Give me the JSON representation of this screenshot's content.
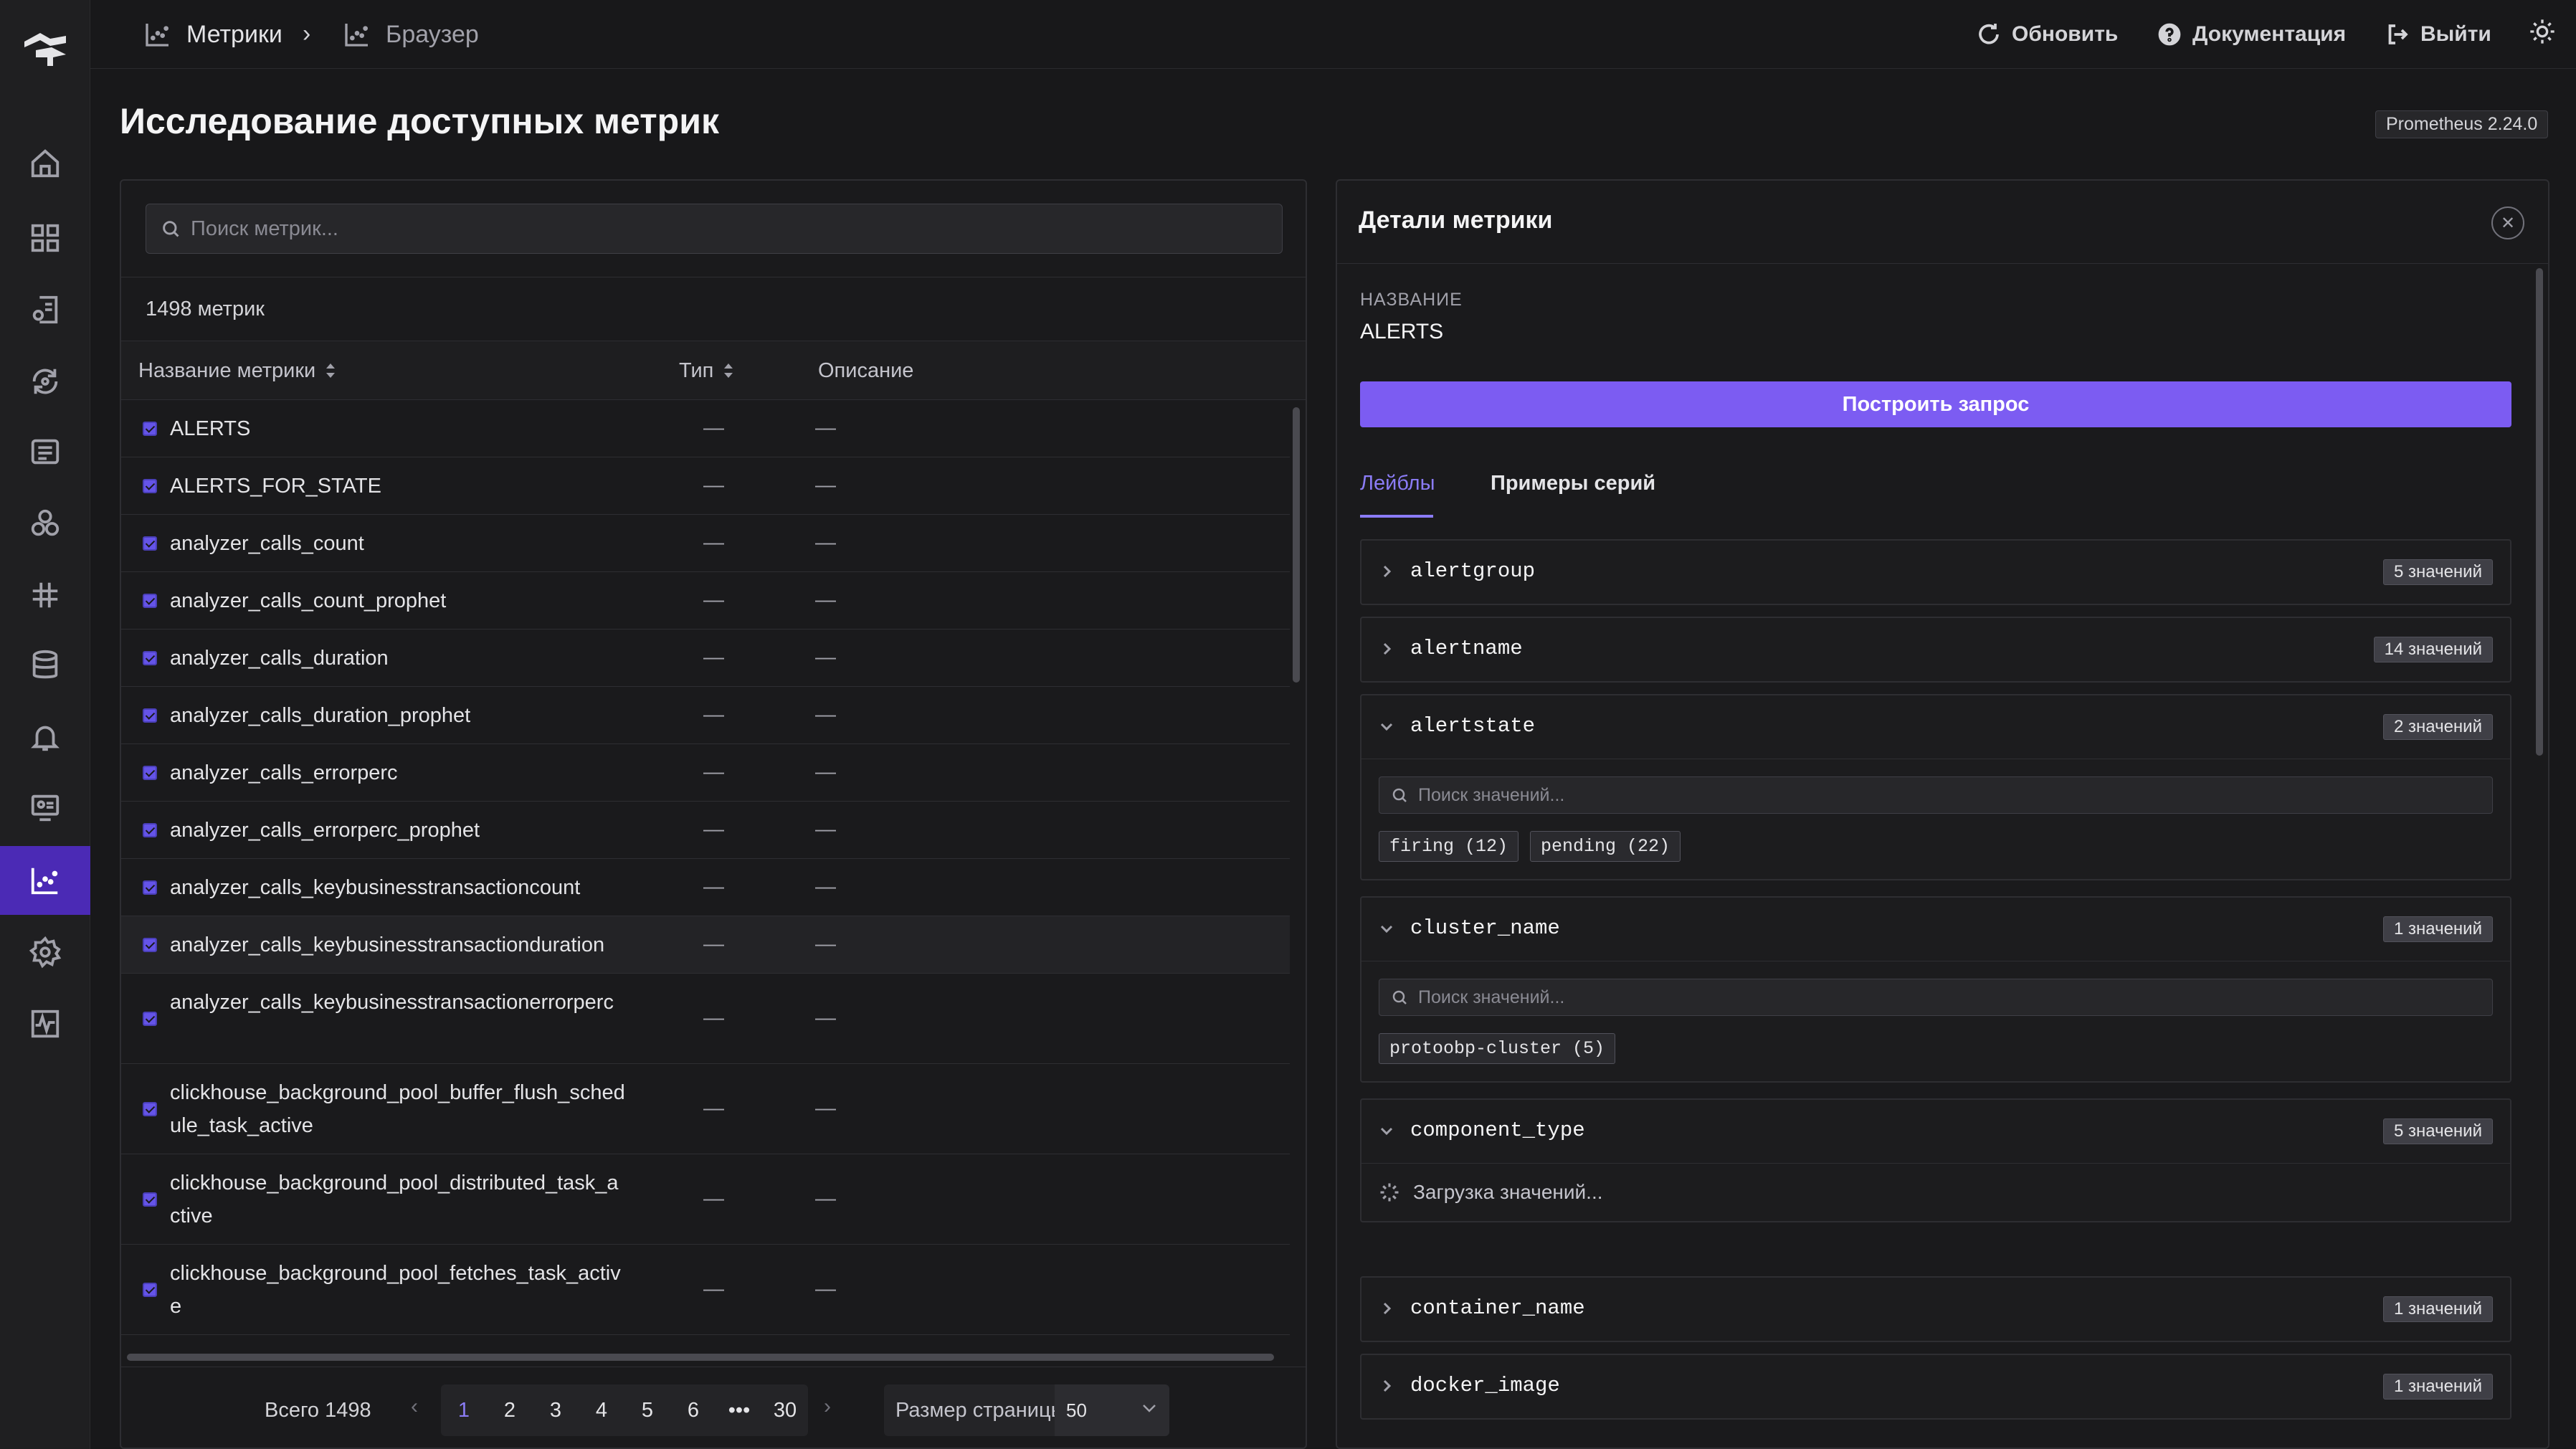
{
  "topbar": {
    "breadcrumb": [
      "Метрики",
      "Браузер"
    ],
    "separator": "›",
    "refresh_label": "Обновить",
    "docs_label": "Документация",
    "logout_label": "Выйти"
  },
  "page": {
    "title": "Исследование доступных метрик",
    "version": "Prometheus 2.24.0"
  },
  "metrics_list": {
    "search_placeholder": "Поиск метрик...",
    "count_text": "1498 метрик",
    "columns": [
      "Название метрики",
      "Тип",
      "Описание"
    ],
    "rows": [
      {
        "name": "ALERTS",
        "type": "—",
        "desc": "—"
      },
      {
        "name": "ALERTS_FOR_STATE",
        "type": "—",
        "desc": "—"
      },
      {
        "name": "analyzer_calls_count",
        "type": "—",
        "desc": "—"
      },
      {
        "name": "analyzer_calls_count_prophet",
        "type": "—",
        "desc": "—"
      },
      {
        "name": "analyzer_calls_duration",
        "type": "—",
        "desc": "—"
      },
      {
        "name": "analyzer_calls_duration_prophet",
        "type": "—",
        "desc": "—"
      },
      {
        "name": "analyzer_calls_errorperc",
        "type": "—",
        "desc": "—"
      },
      {
        "name": "analyzer_calls_errorperc_prophet",
        "type": "—",
        "desc": "—"
      },
      {
        "name": "analyzer_calls_keybusinesstransactioncount",
        "type": "—",
        "desc": "—"
      },
      {
        "name": "analyzer_calls_keybusinesstransactionduration",
        "type": "—",
        "desc": "—"
      },
      {
        "name": "analyzer_calls_keybusinesstransactionerrorperc",
        "type": "—",
        "desc": "—"
      },
      {
        "name": "clickhouse_background_pool_buffer_flush_schedule_task_active",
        "type": "—",
        "desc": "—"
      },
      {
        "name": "clickhouse_background_pool_distributed_task_active",
        "type": "—",
        "desc": "—"
      },
      {
        "name": "clickhouse_background_pool_fetches_task_active",
        "type": "—",
        "desc": "—"
      }
    ],
    "pagination": {
      "total_text": "Всего 1498",
      "prev": "‹",
      "next": "›",
      "pages": [
        "1",
        "2",
        "3",
        "4",
        "5",
        "6",
        "•••",
        "30"
      ],
      "current": "1",
      "page_size_label": "Размер страницы",
      "page_size": "50"
    }
  },
  "details": {
    "title": "Детали метрики",
    "close_icon": "✕",
    "name_label": "НАЗВАНИЕ",
    "name_value": "ALERTS",
    "build_button": "Построить запрос",
    "tabs": [
      "Лейблы",
      "Примеры серий"
    ],
    "active_tab": "Лейблы",
    "value_search_placeholder": "Поиск значений...",
    "loading_text": "Загрузка значений...",
    "labels": [
      {
        "name": "alertgroup",
        "badge": "5 значений",
        "expanded": false
      },
      {
        "name": "alertname",
        "badge": "14 значений",
        "expanded": false
      },
      {
        "name": "alertstate",
        "badge": "2 значений",
        "expanded": true,
        "values": [
          "firing (12)",
          "pending (22)"
        ]
      },
      {
        "name": "cluster_name",
        "badge": "1 значений",
        "expanded": true,
        "values": [
          "protoobp-cluster (5)"
        ]
      },
      {
        "name": "component_type",
        "badge": "5 значений",
        "expanded": true,
        "loading": true
      },
      {
        "name": "container_name",
        "badge": "1 значений",
        "expanded": false
      },
      {
        "name": "docker_image",
        "badge": "1 значений",
        "expanded": false
      }
    ]
  },
  "colors": {
    "accent": "#7c5cf2",
    "active_nav": "#4b2ab5",
    "background": "#18181a"
  },
  "icons": {
    "sidebar": [
      "home-icon",
      "dashboards-icon",
      "explore-icon",
      "sync-icon",
      "logs-icon",
      "services-icon",
      "integrations-icon",
      "database-icon",
      "alerts-icon",
      "monitor-icon",
      "metrics-icon",
      "settings-icon",
      "activity-icon"
    ]
  }
}
